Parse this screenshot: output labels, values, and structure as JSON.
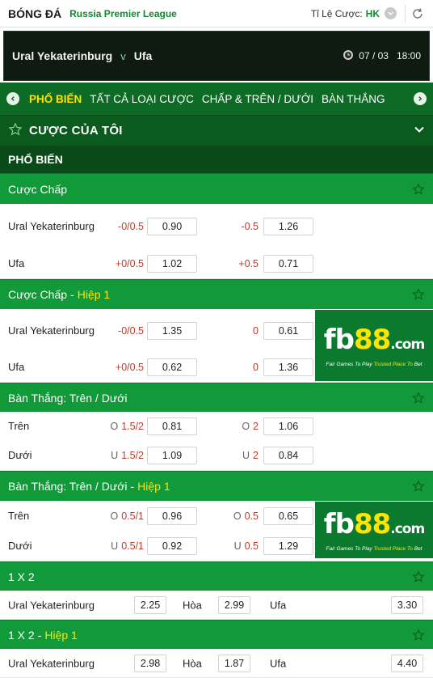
{
  "header": {
    "sport": "BÓNG ĐÁ",
    "league": "Russia Premier League",
    "odds_label": "Tỉ Lệ Cược:",
    "odds_format": "HK"
  },
  "match": {
    "home": "Ural Yekaterinburg",
    "vs": "v",
    "away": "Ufa",
    "date": "07 / 03",
    "time": "18:00"
  },
  "tabs": [
    "PHỔ BIẾN",
    "TẤT CẢ LOẠI CƯỢC",
    "CHẤP & TRÊN / DƯỚI",
    "BÀN THẮNG"
  ],
  "my_bets": "CƯỢC CỦA TÔI",
  "popular": "PHỔ BIẾN",
  "half_suffix": "Hiệp 1",
  "dash": "-",
  "ad": {
    "fb": "fb",
    "num": "88",
    "dom": ".com",
    "tag1": "Fair Games To Play",
    "tag2": "Trusted Place To",
    "tag3": "Bet"
  },
  "handicap": {
    "title": "Cược Chấp",
    "rows": [
      {
        "team": "Ural Yekaterinburg",
        "h1": "-0/0.5",
        "o1": "0.90",
        "h2": "-0.5",
        "o2": "1.26"
      },
      {
        "team": "Ufa",
        "h1": "+0/0.5",
        "o1": "1.02",
        "h2": "+0.5",
        "o2": "0.71"
      }
    ]
  },
  "handicap_h1": {
    "title": "Cược Chấp",
    "rows": [
      {
        "team": "Ural Yekaterinburg",
        "h1": "-0/0.5",
        "o1": "1.35",
        "h2": "0",
        "o2": "0.61"
      },
      {
        "team": "Ufa",
        "h1": "+0/0.5",
        "o1": "0.62",
        "h2": "0",
        "o2": "1.36"
      }
    ]
  },
  "ou": {
    "title": "Bàn Thắng: Trên / Dưới",
    "rows": [
      {
        "label": "Trên",
        "p1": "O",
        "h1": "1.5/2",
        "o1": "0.81",
        "p2": "O",
        "h2": "2",
        "o2": "1.06"
      },
      {
        "label": "Dưới",
        "p1": "U",
        "h1": "1.5/2",
        "o1": "1.09",
        "p2": "U",
        "h2": "2",
        "o2": "0.84"
      }
    ]
  },
  "ou_h1": {
    "title": "Bàn Thắng: Trên / Dưới",
    "rows": [
      {
        "label": "Trên",
        "p1": "O",
        "h1": "0.5/1",
        "o1": "0.96",
        "p2": "O",
        "h2": "0.5",
        "o2": "0.65"
      },
      {
        "label": "Dưới",
        "p1": "U",
        "h1": "0.5/1",
        "o1": "0.92",
        "p2": "U",
        "h2": "0.5",
        "o2": "1.29"
      }
    ]
  },
  "x12": {
    "title": "1 X 2",
    "home": "Ural Yekaterinburg",
    "home_odd": "2.25",
    "draw": "Hòa",
    "draw_odd": "2.99",
    "away": "Ufa",
    "away_odd": "3.30"
  },
  "x12_h1": {
    "title": "1 X 2",
    "home": "Ural Yekaterinburg",
    "home_odd": "2.98",
    "draw": "Hòa",
    "draw_odd": "1.87",
    "away": "Ufa",
    "away_odd": "4.40"
  },
  "colors": {
    "brand_green": "#129a3a",
    "dark_green": "#0b5a1e",
    "highlight_yellow": "#ffe400",
    "handicap_red": "#c0392b"
  }
}
